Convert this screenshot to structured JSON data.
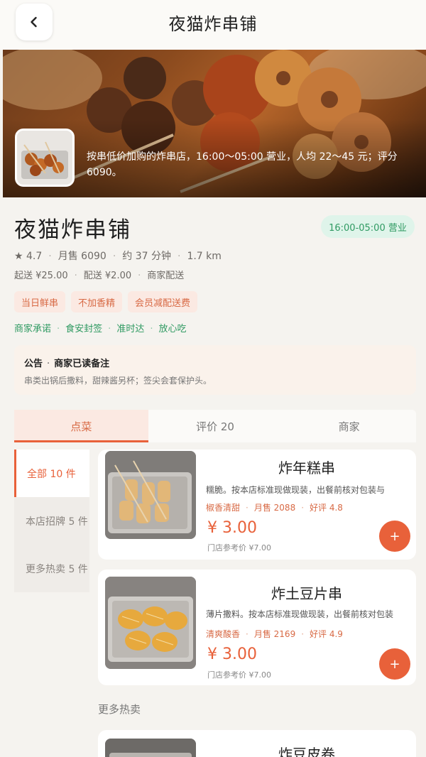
{
  "header": {
    "title": "夜猫炸串铺",
    "back_icon": "chevron-left-icon"
  },
  "hero": {
    "description": "按串低价加购的炸串店，16:00～05:00 营业，人均 22～45 元；评分 6090。"
  },
  "store": {
    "name": "夜猫炸串铺",
    "hours_badge": "16:00-05:00 营业",
    "rating": "★ 4.7",
    "monthly_sales": "月售 6090",
    "delivery_time": "约 37 分钟",
    "distance": "1.7 km",
    "min_order": "起送 ¥25.00",
    "delivery_fee": "配送 ¥2.00",
    "delivery_type": "商家配送",
    "tags": [
      "当日鲜串",
      "不加香精",
      "会员减配送费"
    ],
    "promises": [
      "商家承诺",
      "食安封签",
      "准时达",
      "放心吃"
    ],
    "colors": {
      "accent": "#e8613a",
      "green": "#2f9a62",
      "tag_bg": "#fbe9e2"
    }
  },
  "notice": {
    "label": "公告",
    "status": "商家已读备注",
    "text": "串类出锅后撒料，甜辣酱另杯；签尖会套保护头。"
  },
  "tabs": [
    {
      "label": "点菜",
      "active": true
    },
    {
      "label": "评价 20",
      "active": false
    },
    {
      "label": "商家",
      "active": false
    }
  ],
  "categories": [
    {
      "label": "全部 10 件",
      "active": true
    },
    {
      "label": "本店招牌 5 件",
      "active": false
    },
    {
      "label": "更多热卖 5 件",
      "active": false
    }
  ],
  "products": [
    {
      "name": "炸年糕串",
      "desc": "糯脆。按本店标准现做现装，出餐前核对包装与",
      "flavor": "椒香清甜",
      "sales": "月售 2088",
      "rating": "好评 4.8",
      "price": "¥ 3.00",
      "ref_price": "门店参考价 ¥7.00",
      "add_label": "+"
    },
    {
      "name": "炸土豆片串",
      "desc": "薄片撒料。按本店标准现做现装，出餐前核对包装",
      "flavor": "清爽酸香",
      "sales": "月售 2169",
      "rating": "好评 4.9",
      "price": "¥ 3.00",
      "ref_price": "门店参考价 ¥7.00",
      "add_label": "+"
    },
    {
      "name": "炸豆皮卷"
    }
  ],
  "sections": {
    "more_hot": "更多热卖"
  }
}
